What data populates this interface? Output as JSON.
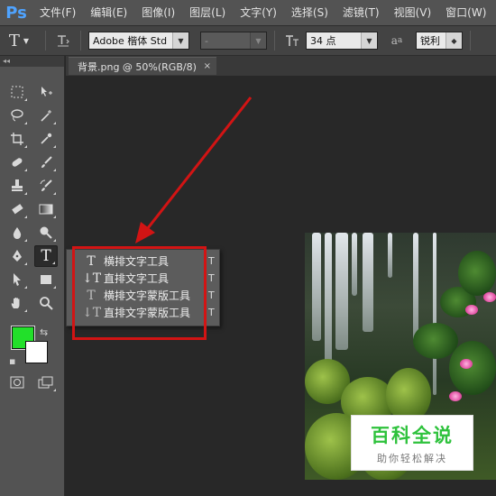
{
  "menubar": {
    "logo": "Ps",
    "items": [
      "文件(F)",
      "编辑(E)",
      "图像(I)",
      "图层(L)",
      "文字(Y)",
      "选择(S)",
      "滤镜(T)",
      "视图(V)",
      "窗口(W)"
    ]
  },
  "options": {
    "tool_icon": "T",
    "orient_icon": "text-orientation-icon",
    "font_family": "Adobe 楷体 Std",
    "font_style": "-",
    "size_icon": "font-size-icon",
    "font_size": "34 点",
    "aa_icon": "a",
    "antialias": "锐利"
  },
  "document": {
    "tab_title": "背景.png @ 50%(RGB/8)",
    "close": "×"
  },
  "flyout": {
    "items": [
      {
        "icon": "T",
        "label": "横排文字工具",
        "shortcut": "T"
      },
      {
        "icon": "↓T",
        "label": "直排文字工具",
        "shortcut": "T"
      },
      {
        "icon": "T",
        "label": "横排文字蒙版工具",
        "shortcut": "T"
      },
      {
        "icon": "↓T",
        "label": "直排文字蒙版工具",
        "shortcut": "T"
      }
    ]
  },
  "watermark": {
    "title": "百科全说",
    "subtitle": "助你轻松解决"
  },
  "colors": {
    "foreground": "#22e02a",
    "background": "#ffffff",
    "annotation": "#d21414"
  },
  "toolbar": {
    "collapse": "◂◂",
    "tools": [
      "marquee-icon",
      "move-icon",
      "lasso-icon",
      "magic-wand-icon",
      "crop-icon",
      "eyedropper-icon",
      "healing-icon",
      "brush-icon",
      "stamp-icon",
      "history-brush-icon",
      "eraser-icon",
      "gradient-icon",
      "blur-icon",
      "dodge-icon",
      "pen-icon",
      "type-icon",
      "path-select-icon",
      "rectangle-icon",
      "hand-icon",
      "zoom-icon",
      "quick-mask-icon",
      "screen-mode-icon"
    ]
  }
}
